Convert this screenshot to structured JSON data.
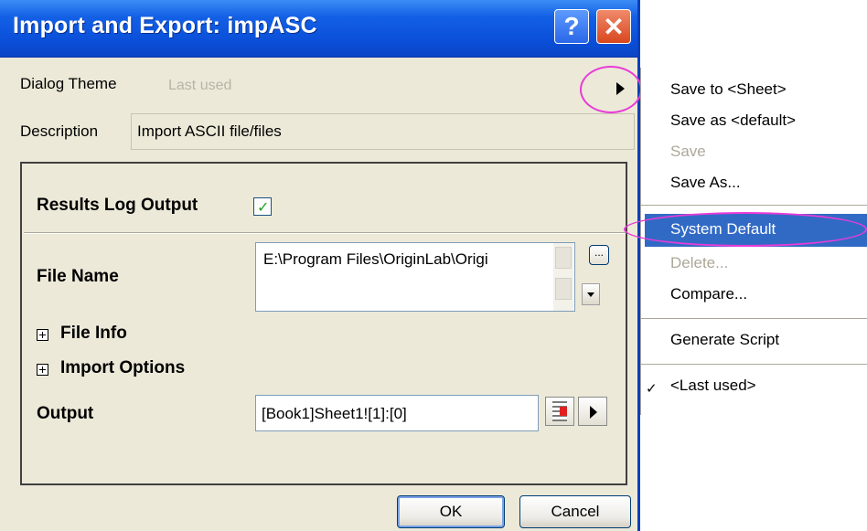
{
  "dialog": {
    "title": "Import and Export: impASC",
    "help_label": "?",
    "close_label": "✕",
    "theme_label": "Dialog Theme",
    "theme_value": "Last used",
    "description_label": "Description",
    "description_value": "Import ASCII file/files",
    "results_log_label": "Results Log Output",
    "results_log_checked": true,
    "file_name_label": "File Name",
    "file_name_value": "E:\\Program Files\\OriginLab\\Origi",
    "browse_label": "...",
    "file_info_label": "File Info",
    "import_options_label": "Import Options",
    "output_label": "Output",
    "output_value": "[Book1]Sheet1![1]:[0]",
    "ok_label": "OK",
    "cancel_label": "Cancel"
  },
  "menu": {
    "items": [
      {
        "label": "Save to <Sheet>",
        "enabled": true
      },
      {
        "label": "Save as <default>",
        "enabled": true
      },
      {
        "label": "Save",
        "enabled": false
      },
      {
        "label": "Save As...",
        "enabled": true
      },
      {
        "label": "System Default",
        "enabled": true,
        "selected": true
      },
      {
        "label": "Delete...",
        "enabled": false
      },
      {
        "label": "Compare...",
        "enabled": true
      },
      {
        "label": "Generate Script",
        "enabled": true
      },
      {
        "label": "<Last used>",
        "enabled": true,
        "checked": true
      }
    ]
  },
  "colors": {
    "titlebar": "#0a4ed8",
    "selection": "#316ac5",
    "highlight_ring": "#e83cd8"
  }
}
